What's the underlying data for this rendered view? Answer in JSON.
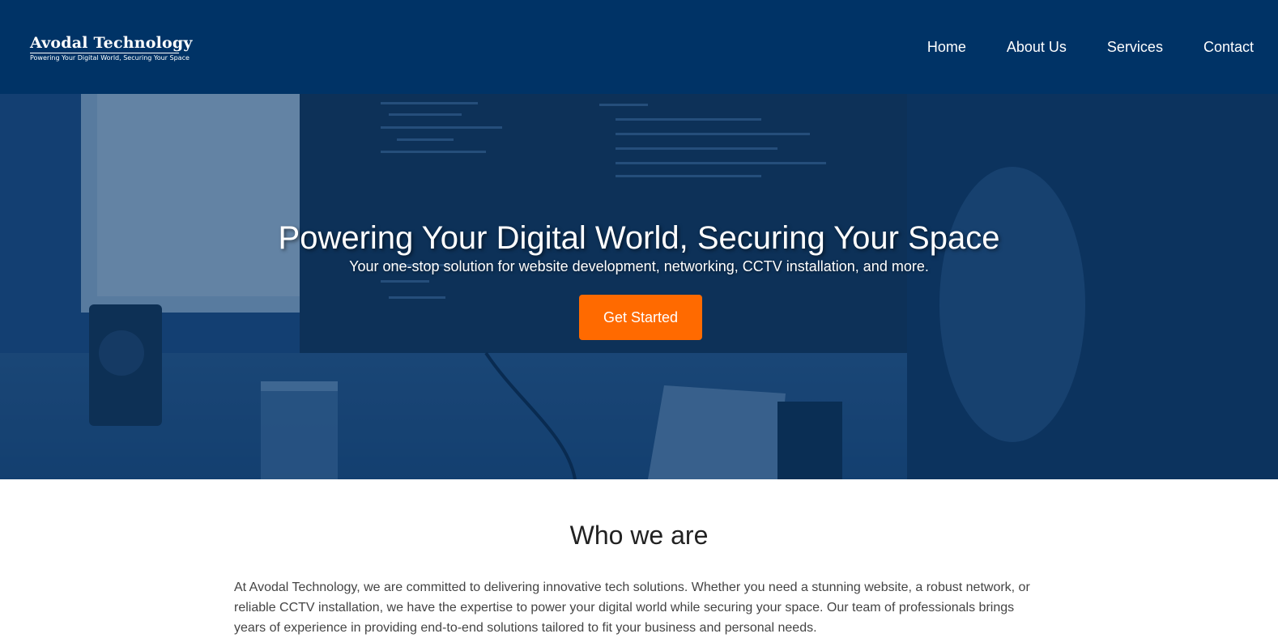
{
  "header": {
    "logo_name": "Avodal Technology",
    "logo_tagline": "Powering Your Digital World, Securing Your Space",
    "nav": [
      {
        "label": "Home"
      },
      {
        "label": "About Us"
      },
      {
        "label": "Services"
      },
      {
        "label": "Contact"
      }
    ],
    "background_color": "#003366"
  },
  "hero": {
    "title": "Powering Your Digital World, Securing Your Space",
    "subtitle": "Your one-stop solution for website development, networking, CCTV installation, and more.",
    "cta_label": "Get Started",
    "cta_color": "#ff6a00",
    "overlay_color": "#003366"
  },
  "about": {
    "title": "Who we are",
    "text": "At Avodal Technology, we are committed to delivering innovative tech solutions. Whether you need a stunning website, a robust network, or reliable CCTV installation, we have the expertise to power your digital world while securing your space. Our team of professionals brings years of experience in providing end-to-end solutions tailored to fit your business and personal needs."
  }
}
